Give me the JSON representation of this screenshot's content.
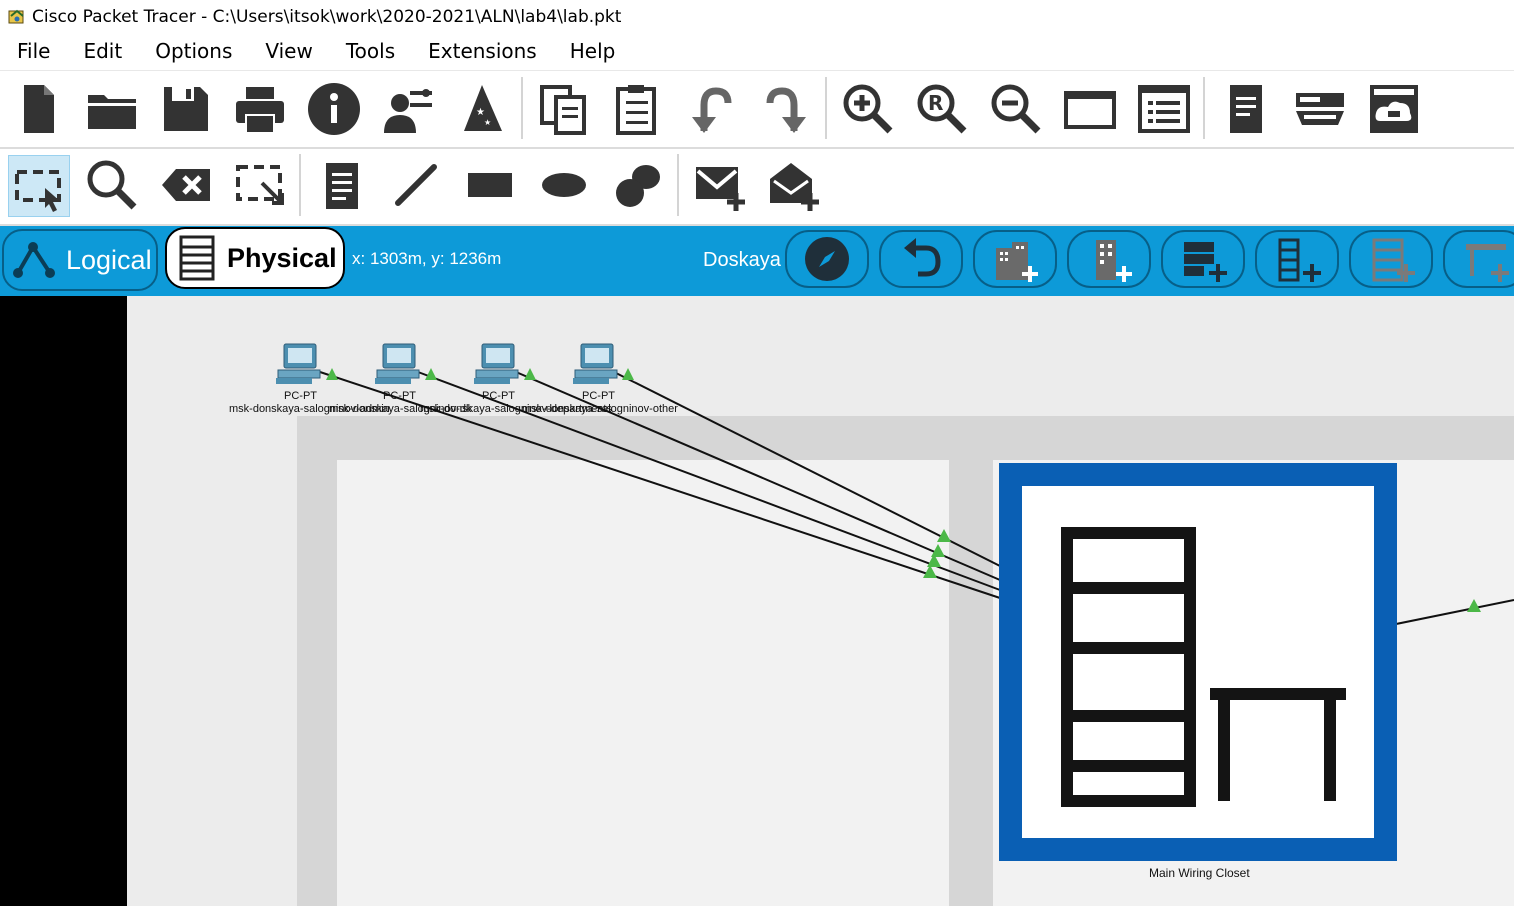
{
  "window": {
    "title": "Cisco Packet Tracer - C:\\Users\\itsok\\work\\2020-2021\\ALN\\lab4\\lab.pkt"
  },
  "menu": [
    "File",
    "Edit",
    "Options",
    "View",
    "Tools",
    "Extensions",
    "Help"
  ],
  "toolbar_main": [
    "new-file-icon",
    "open-folder-icon",
    "save-icon",
    "print-icon",
    "info-icon",
    "activity-wizard-icon",
    "wizard-hat-icon",
    "copy-icon",
    "paste-icon",
    "undo-icon",
    "redo-icon",
    "zoom-in-icon",
    "zoom-reset-icon",
    "zoom-out-icon",
    "window-icon",
    "list-icon",
    "notes-icon",
    "device-icon",
    "cloud-device-icon"
  ],
  "toolbar_tools": [
    "select-icon",
    "inspect-icon",
    "delete-icon",
    "resize-icon",
    "note-icon",
    "line-icon",
    "rectangle-icon",
    "ellipse-icon",
    "freeform-icon",
    "add-simple-pdu-icon",
    "add-complex-pdu-icon"
  ],
  "workspace_bar": {
    "logical_label": "Logical",
    "physical_label": "Physical",
    "coordinates": "x: 1303m, y: 1236m",
    "location": "Doskaya"
  },
  "canvas": {
    "pcs": [
      {
        "type": "PC-PT",
        "name": "msk-donskaya-salogninov-admin"
      },
      {
        "type": "PC-PT",
        "name": "msk-donskaya-salogninov-dk"
      },
      {
        "type": "PC-PT",
        "name": "msk-donskaya-salogninov-departments"
      },
      {
        "type": "PC-PT",
        "name": "msk-donskaya-salogninov-other"
      }
    ],
    "closet_label": "Main Wiring Closet"
  },
  "colors": {
    "accent": "#0d9ad8",
    "closet_frame": "#0a5fb4",
    "link_triangle": "#4cb848"
  }
}
